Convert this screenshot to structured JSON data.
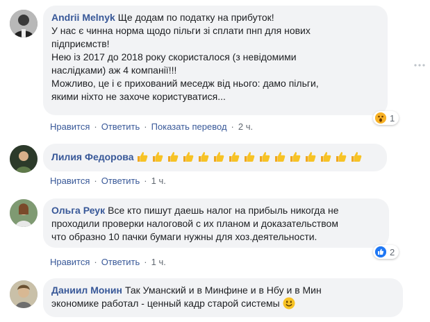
{
  "comments": [
    {
      "author": "Andrii Melnyk",
      "text": "Ще додам по податку на прибуток!\nУ нас є чинна норма щодо пільги зі сплати пнп для нових\nпідприємств!\nНею із 2017 до 2018 року скористалося (з невідомими\nнаслідками) аж 4 компанії!!!\nМожливо, це і є прихований меседж від нього: дамо пільги,\nякими ніхто не захоче користуватися...",
      "like": "Нравится",
      "reply": "Ответить",
      "translate": "Показать перевод",
      "time": "2 ч.",
      "reaction_icon": "wow-reaction-icon",
      "reaction_count": "1"
    },
    {
      "author": "Лилия Федорова",
      "thumbs_count": 15,
      "like": "Нравится",
      "reply": "Ответить",
      "time": "1 ч."
    },
    {
      "author": "Ольга Реук",
      "text": "Все кто пишут даешь налог на прибыль никогда не\nпроходили проверки налоговой с их планом и доказательством\nчто образно 10 пачки бумаги нужны для хоз.деятельности.",
      "like": "Нравится",
      "reply": "Ответить",
      "time": "1 ч.",
      "reaction_icon": "like-reaction-icon",
      "reaction_count": "2"
    },
    {
      "author": "Даниил Монин",
      "text": "Так Уманский и в Минфине и в Нбу и в Мин\nэкономике работал - ценный кадр старой системы",
      "emoji": "smiling-face-emoji"
    }
  ],
  "colors": {
    "author": "#385898",
    "bubble": "#f2f3f5",
    "meta": "#606770",
    "wow": "#f7b125",
    "like": "#2078f4"
  }
}
